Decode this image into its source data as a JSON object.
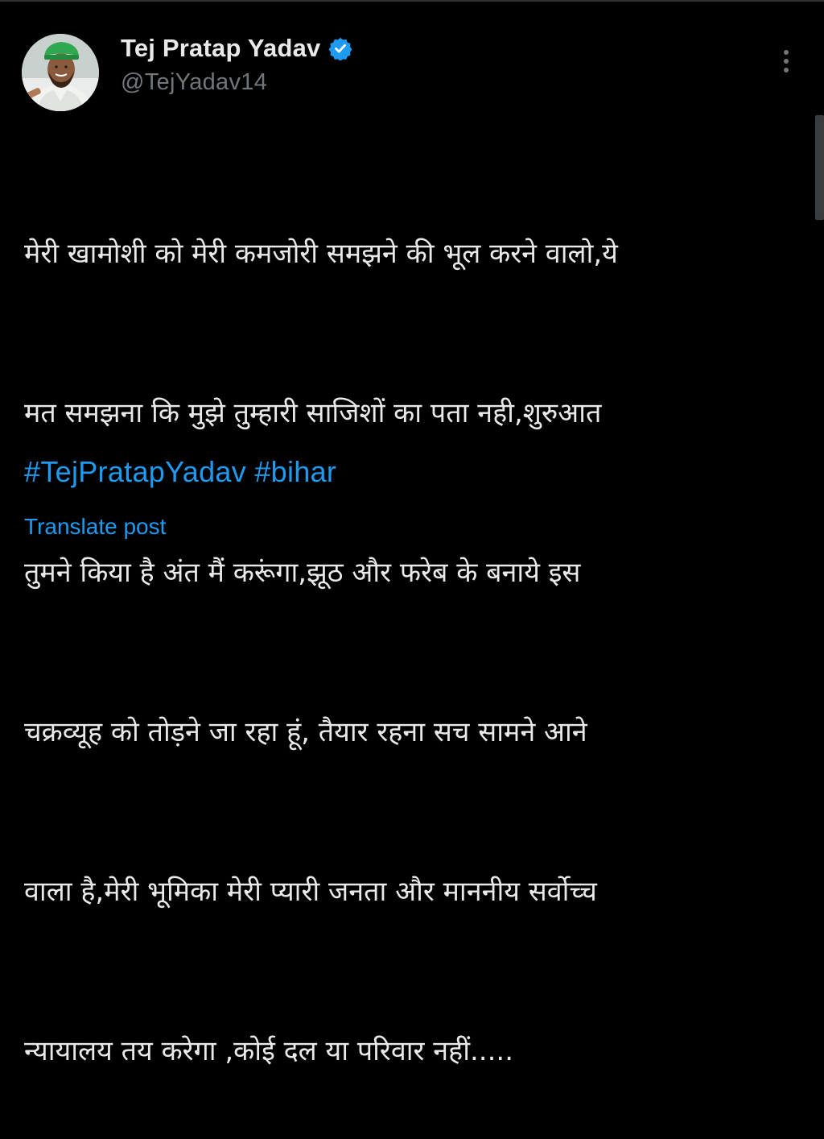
{
  "author": {
    "display_name": "Tej Pratap Yadav",
    "handle": "@TejYadav14",
    "verified": true,
    "avatar_icon": "profile-photo"
  },
  "post": {
    "lines": [
      "मेरी खामोशी को मेरी कमजोरी समझने की भूल करने वालो,ये",
      "मत समझना कि मुझे तुम्हारी साजिशों का पता नही,शुरुआत",
      "तुमने किया है अंत मैं करूंगा,झूठ और फरेब के बनाये इस",
      "चक्रव्यूह को तोड़ने जा रहा हूं, तैयार रहना सच सामने आने",
      "वाला है,मेरी भूमिका मेरी प्यारी जनता और माननीय सर्वोच्च",
      "न्यायालय तय करेगा ,कोई दल या परिवार नहीं....."
    ],
    "hashtags": [
      "#TejPratapYadav",
      "#bihar"
    ],
    "translate_label": "Translate post"
  },
  "icons": {
    "verified": "verified-badge-icon",
    "more": "more-options-icon"
  },
  "colors": {
    "background": "#000000",
    "text": "#e7e9ea",
    "secondary_text": "#71767b",
    "link": "#1d9bf0",
    "verified_badge": "#1d9bf0"
  }
}
